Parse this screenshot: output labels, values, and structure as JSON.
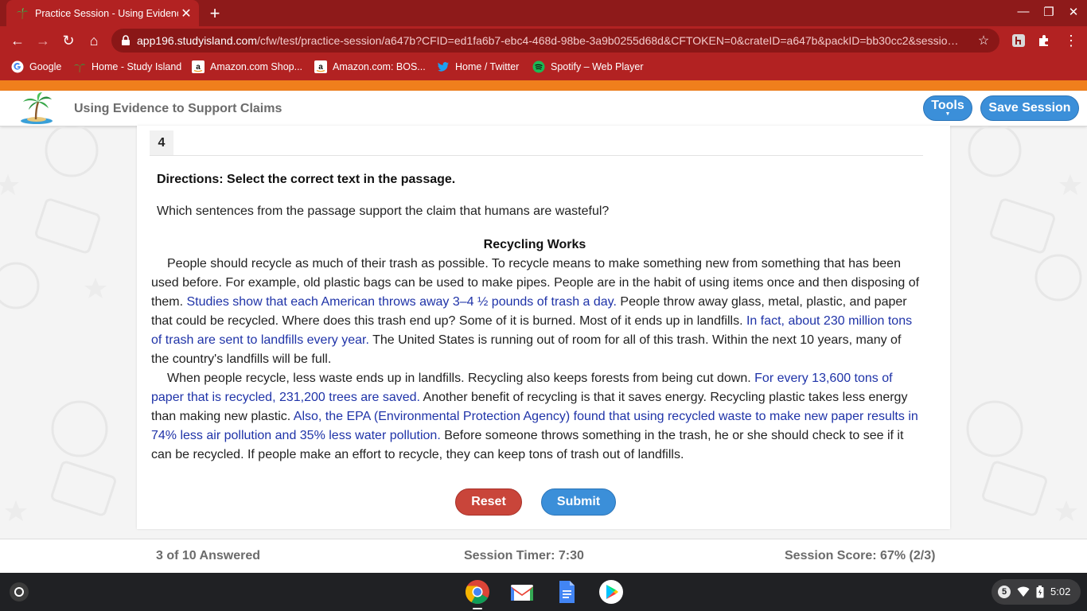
{
  "browser": {
    "tab_title": "Practice Session - Using Evidence to Support Claims",
    "new_tab": "+",
    "url_host": "app196.studyisland.com",
    "url_path": "/cfw/test/practice-session/a647b?CFID=ed1fa6b7-ebc4-468d-98be-3a9b0255d68d&CFTOKEN=0&crateID=a647b&packID=bb30cc2&sessio…",
    "bookmarks": [
      {
        "label": "Google",
        "icon": "google-icon"
      },
      {
        "label": "Home - Study Island",
        "icon": "palm-tree-icon"
      },
      {
        "label": "Amazon.com Shop...",
        "icon": "amazon-icon"
      },
      {
        "label": "Amazon.com: BOS...",
        "icon": "amazon-icon"
      },
      {
        "label": "Home / Twitter",
        "icon": "twitter-icon"
      },
      {
        "label": "Spotify – Web Player",
        "icon": "spotify-icon"
      }
    ]
  },
  "header": {
    "lesson_title": "Using Evidence to Support Claims",
    "tools_label": "Tools",
    "save_label": "Save Session"
  },
  "question": {
    "number": "4",
    "directions": "Directions: Select the correct text in the passage.",
    "prompt": "Which sentences from the passage support the claim that humans are wasteful?",
    "passage_title": "Recycling Works",
    "p1": {
      "s1": "People should recycle as much of their trash as possible. To recycle means to make something new from something that has been used before. For example, old plastic bags can be used to make pipes. People are in the habit of using items once and then disposing of them.",
      "sel1": "Studies show that each American throws away 3–4 ½ pounds of trash a day.",
      "s2": "People throw away glass, metal, plastic, and paper that could be recycled. Where does this trash end up? Some of it is burned. Most of it ends up in landfills.",
      "sel2": "In fact, about 230 million tons of trash are sent to landfills every year.",
      "s3": "The United States is running out of room for all of this trash. Within the next 10 years, many of the country's landfills will be full."
    },
    "p2": {
      "s1": "When people recycle, less waste ends up in landfills. Recycling also keeps forests from being cut down.",
      "sel1": "For every 13,600 tons of paper that is recycled, 231,200 trees are saved.",
      "s2": "Another benefit of recycling is that it saves energy. Recycling plastic takes less energy than making new plastic.",
      "sel2": "Also, the EPA (Environmental Protection Agency) found that using recycled waste to make new paper results in 74% less air pollution and 35% less water pollution.",
      "s3": "Before someone throws something in the trash, he or she should check to see if it can be recycled. If people make an effort to recycle, they can keep tons of trash out of landfills."
    },
    "reset_label": "Reset",
    "submit_label": "Submit"
  },
  "footer": {
    "answered": "3 of 10 Answered",
    "timer": "Session Timer: 7:30",
    "score": "Session Score: 67% (2/3)"
  },
  "shelf": {
    "notification_count": "5",
    "time": "5:02",
    "apps": [
      "chrome-icon",
      "gmail-icon",
      "docs-icon",
      "play-store-icon"
    ]
  },
  "colors": {
    "chrome_red": "#b22222",
    "accent_orange": "#f07f1c",
    "button_blue": "#3b8fd9",
    "reset_red": "#c9453a",
    "selectable_text": "#1f33a8"
  }
}
